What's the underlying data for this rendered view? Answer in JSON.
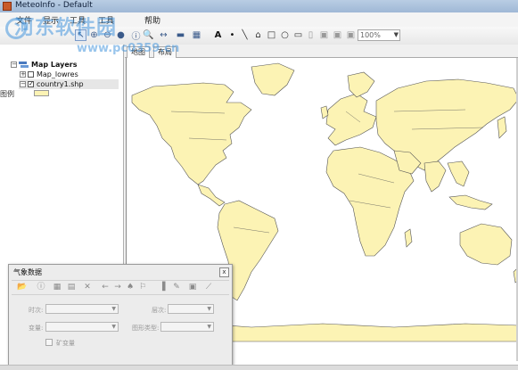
{
  "window": {
    "title": "MeteoInfo - Default"
  },
  "menu": [
    "文件",
    "显示",
    "工具",
    "工具",
    "帮助"
  ],
  "toolbar": {
    "zoom_value": "100%"
  },
  "watermark": {
    "text": "河东软件园",
    "url": "www.pc0359.cn"
  },
  "left_panel": {
    "tab_label": "图例",
    "root_label": "Map Layers",
    "layers": [
      {
        "label": "Map_lowres",
        "checked": false
      },
      {
        "label": "country1.shp",
        "checked": true
      }
    ]
  },
  "map_tabs": [
    "地图",
    "布局"
  ],
  "colors": {
    "land": "#fcf3b4",
    "ocean": "#ffffff",
    "border": "#555555"
  },
  "met_panel": {
    "title": "气象数据",
    "close_label": "x",
    "labels": {
      "time": "时次:",
      "level": "层次:",
      "variable": "变量:",
      "graph_type": "图形类型:",
      "dynamic": "矿变量"
    }
  }
}
